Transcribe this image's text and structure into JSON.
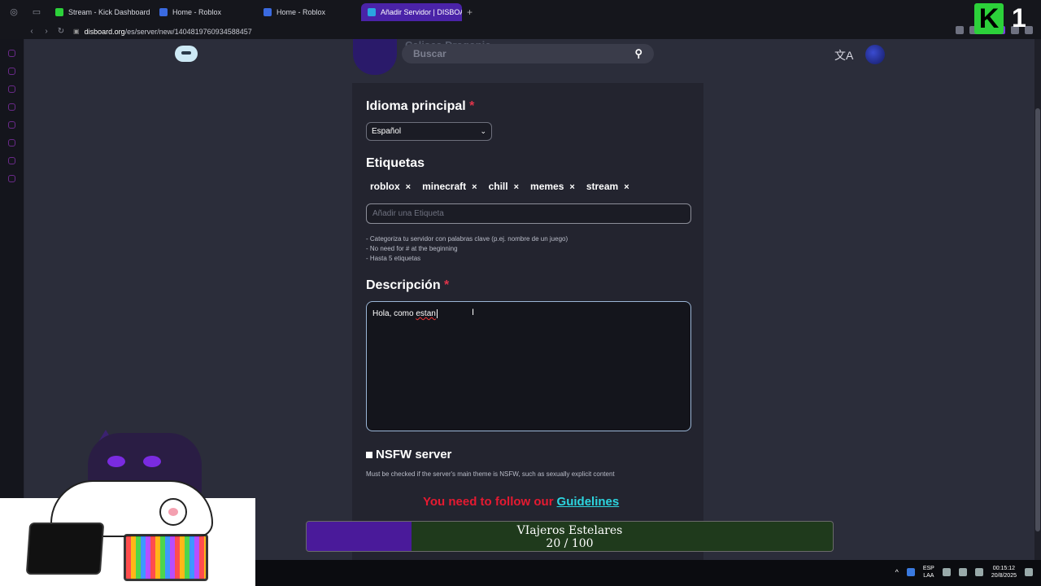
{
  "browser": {
    "tabs": [
      {
        "label": "Stream - Kick Dashboard",
        "favicon_color": "#2cd13a",
        "active": false
      },
      {
        "label": "Home - Roblox",
        "favicon_color": "#3a6ae0",
        "active": false
      },
      {
        "label": "Home - Roblox",
        "favicon_color": "#3a6ae0",
        "active": false
      },
      {
        "label": "Añadir Servidor | DISBOARD",
        "favicon_color": "#2aa6e0",
        "active": true
      }
    ],
    "url_host": "disboard.org",
    "url_path": "/es/server/new/1404819760934588457"
  },
  "header": {
    "search_placeholder": "Buscar",
    "server_name_ghost": "Calisca Dragonic"
  },
  "form": {
    "language": {
      "label": "Idioma principal",
      "required_mark": "*",
      "selected": "Español"
    },
    "tags": {
      "label": "Etiquetas",
      "items": [
        "roblox",
        "minecraft",
        "chill",
        "memes",
        "stream"
      ],
      "remove_glyph": "×",
      "input_placeholder": "Añadir una Etiqueta",
      "hints": [
        "- Categoriza tu servidor con palabras clave (p.ej. nombre de un juego)",
        "- No need for # at the beginning",
        "- Hasta 5 etiquetas"
      ]
    },
    "description": {
      "label": "Descripción",
      "required_mark": "*",
      "value_plain": "Hola, como ",
      "value_misspelled": "estan"
    },
    "nsfw": {
      "label": "NSFW server",
      "note": "Must be checked if the server's main theme is NSFW, such as sexually explicit content"
    },
    "guidelines": {
      "text": "You need to follow our",
      "link": "Guidelines"
    }
  },
  "overlay": {
    "goal_title": "VIajeros Estelares",
    "goal_count": "20 / 100",
    "goal_progress": 0.2,
    "kick_letter": "K",
    "kick_count": "1"
  },
  "taskbar": {
    "lang_top": "ESP",
    "lang_bottom": "LAA",
    "time": "00:15:12",
    "date": "20/8/2025"
  },
  "colors": {
    "required": "#e0344a",
    "guidelines_warning": "#e51a31",
    "guidelines_link": "#2cd6e0",
    "goal_fill": "#4a1a9a",
    "goal_track": "#1f3a1c"
  }
}
